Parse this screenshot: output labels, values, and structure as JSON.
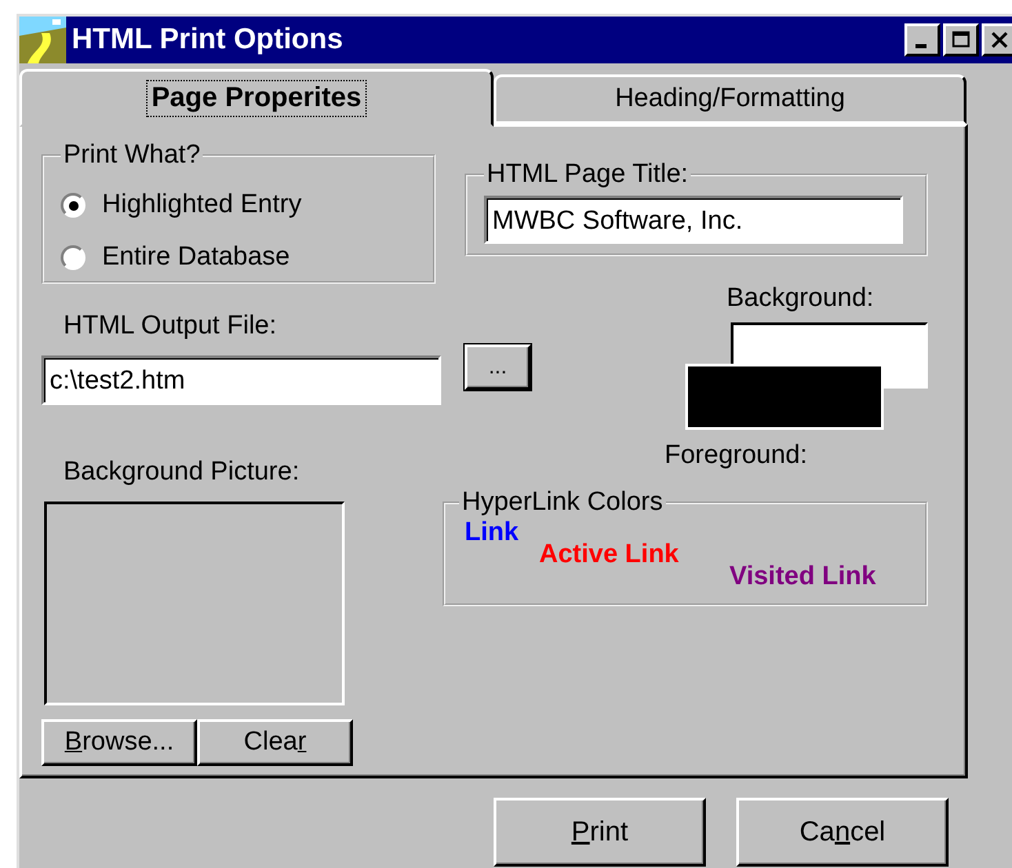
{
  "window": {
    "title": "HTML Print Options"
  },
  "tabs": [
    {
      "label": "Page Properites",
      "selected": true
    },
    {
      "label": "Heading/Formatting",
      "selected": false
    }
  ],
  "print_what": {
    "label": "Print What?",
    "options": [
      {
        "label": "Highlighted Entry",
        "selected": true
      },
      {
        "label": "Entire Database",
        "selected": false
      }
    ]
  },
  "page_title": {
    "label": "HTML Page Title:",
    "value": "MWBC Software, Inc."
  },
  "output_file": {
    "label": "HTML Output File:",
    "value": "c:\\test2.htm",
    "browse_button": "..."
  },
  "background": {
    "label": "Background:",
    "color": "#ffffff"
  },
  "foreground": {
    "label": "Foreground:",
    "color": "#000000"
  },
  "background_picture": {
    "label": "Background Picture:",
    "buttons": [
      {
        "key": "B",
        "post": "rowse..."
      },
      {
        "pre": "Clea",
        "key": "r"
      }
    ]
  },
  "hyperlink_colors": {
    "label": "HyperLink Colors",
    "links": [
      {
        "label": "Link",
        "color": "#0000ff"
      },
      {
        "label": "Active Link",
        "color": "#ff0000"
      },
      {
        "label": "Visited Link",
        "color": "#800080"
      }
    ]
  },
  "buttons": [
    {
      "key": "P",
      "post": "rint"
    },
    {
      "pre": "Ca",
      "key": "n",
      "post": "cel"
    }
  ]
}
